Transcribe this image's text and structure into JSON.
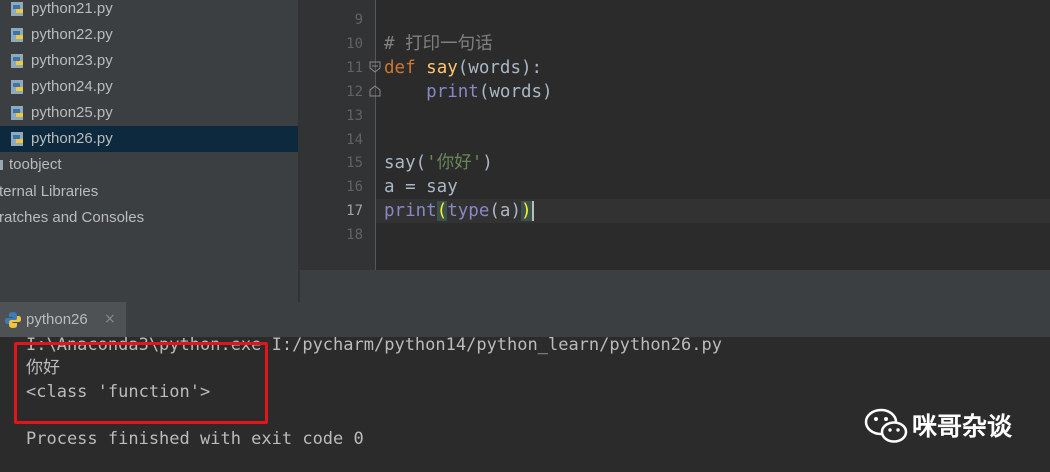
{
  "project_tree": {
    "items": [
      {
        "label": "python21.py",
        "icon": "python-file-icon"
      },
      {
        "label": "python22.py",
        "icon": "python-file-icon"
      },
      {
        "label": "python23.py",
        "icon": "python-file-icon"
      },
      {
        "label": "python24.py",
        "icon": "python-file-icon"
      },
      {
        "label": "python25.py",
        "icon": "python-file-icon"
      },
      {
        "label": "python26.py",
        "icon": "python-file-icon",
        "selected": true
      }
    ],
    "folders": [
      {
        "label": "toobject"
      },
      {
        "label": "ternal Libraries"
      },
      {
        "label": "ratches and Consoles"
      }
    ]
  },
  "editor": {
    "line_numbers": [
      "9",
      "10",
      "11",
      "12",
      "13",
      "14",
      "15",
      "16",
      "17",
      "18"
    ],
    "current_line": "17",
    "code": {
      "l10_comment": "# 打印一句话",
      "l11_def": "def",
      "l11_name": "say",
      "l11_params": "(words):",
      "l12_print": "print",
      "l12_args": "(words)",
      "l15_call": "say(",
      "l15_str": "'你好'",
      "l15_close": ")",
      "l16_text": "a = say",
      "l17_print": "print",
      "l17_open": "(",
      "l17_type": "type",
      "l17_args": "(a)",
      "l17_close": ")"
    }
  },
  "run_panel": {
    "tab_label": "python26",
    "close_icon": "×"
  },
  "console": {
    "command": "I:\\Anaconda3\\python.exe I:/pycharm/python14/python_learn/python26.py",
    "output_1": "你好",
    "output_2": "<class 'function'>",
    "exit_message": "Process finished with exit code 0"
  },
  "watermark": {
    "text": "咪哥杂谈",
    "icon": "wechat-icon"
  },
  "colors": {
    "editor_bg": "#2b2b2b",
    "panel_bg": "#3c3f41",
    "selection": "#0d293e",
    "keyword": "#cc7832",
    "function_name": "#ffc66d",
    "builtin": "#8888c6",
    "string": "#6a8759",
    "comment": "#808080",
    "highlight_box": "#e0161b"
  }
}
